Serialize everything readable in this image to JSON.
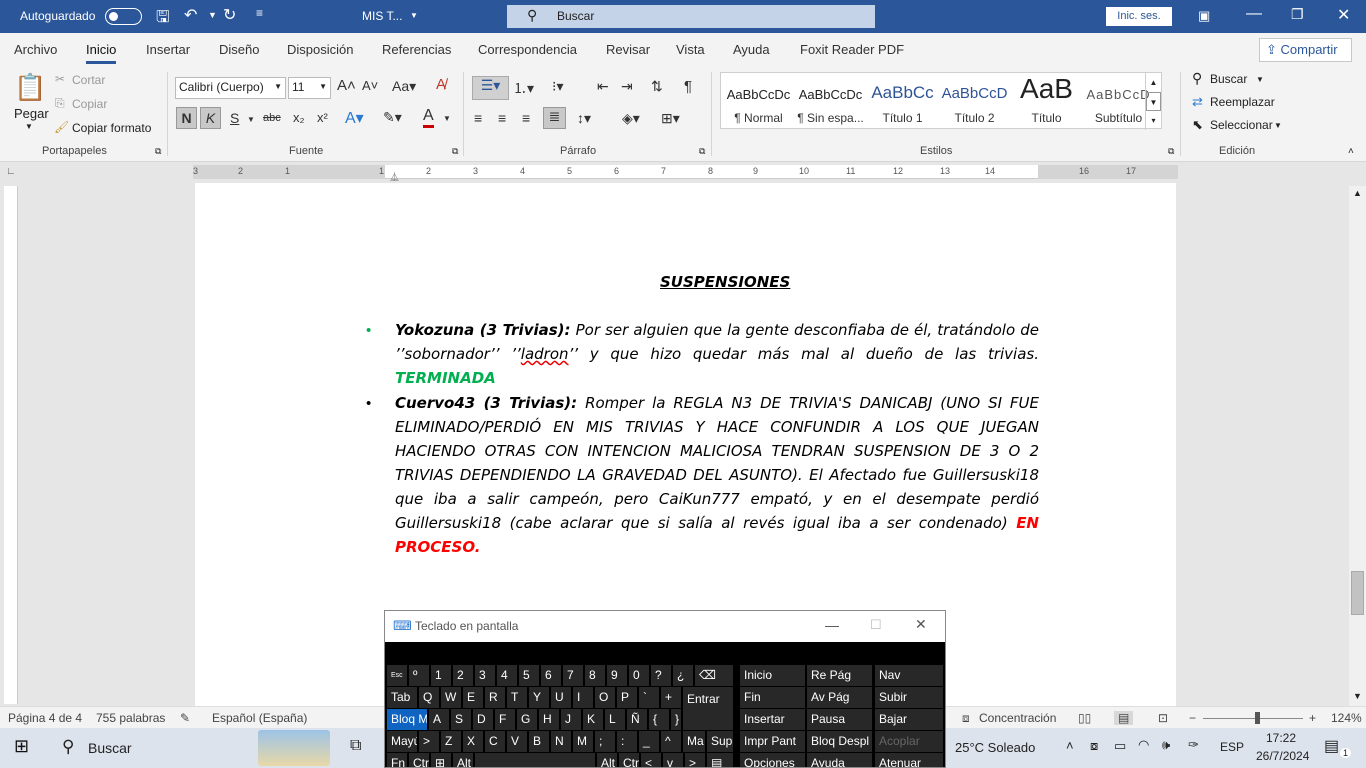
{
  "titlebar": {
    "autosave_label": "Autoguardado",
    "doc_title": "MIS T...",
    "search_placeholder": "Buscar",
    "signin_label": "Inic. ses."
  },
  "menu": {
    "tabs": [
      "Archivo",
      "Inicio",
      "Insertar",
      "Diseño",
      "Disposición",
      "Referencias",
      "Correspondencia",
      "Revisar",
      "Vista",
      "Ayuda",
      "Foxit Reader PDF"
    ],
    "share_label": "Compartir"
  },
  "ribbon": {
    "clipboard": {
      "paste": "Pegar",
      "cut": "Cortar",
      "copy": "Copiar",
      "format_painter": "Copiar formato",
      "group": "Portapapeles"
    },
    "font": {
      "font_name": "Calibri (Cuerpo)",
      "font_size": "11",
      "bold": "N",
      "italic": "K",
      "underline": "S",
      "strike": "abc",
      "subscript": "x₂",
      "superscript": "x²",
      "group": "Fuente"
    },
    "paragraph": {
      "group": "Párrafo"
    },
    "styles": {
      "group": "Estilos",
      "items": [
        {
          "preview": "AaBbCcDc",
          "name": "¶ Normal"
        },
        {
          "preview": "AaBbCcDc",
          "name": "¶ Sin espa..."
        },
        {
          "preview": "AaBbCc",
          "name": "Título 1"
        },
        {
          "preview": "AaBbCcD",
          "name": "Título 2"
        },
        {
          "preview": "AaB",
          "name": "Título"
        },
        {
          "preview": "AaBbCcD",
          "name": "Subtítulo"
        }
      ]
    },
    "editing": {
      "find": "Buscar",
      "replace": "Reemplazar",
      "select": "Seleccionar",
      "group": "Edición"
    }
  },
  "ruler": {
    "marks": [
      "3",
      "2",
      "1",
      "1",
      "2",
      "3",
      "4",
      "5",
      "6",
      "7",
      "8",
      "9",
      "10",
      "11",
      "12",
      "13",
      "14",
      "16",
      "17"
    ]
  },
  "document": {
    "title": "SUSPENSIONES",
    "items": [
      {
        "name": "Yokozuna (3 Trivias):",
        "text1": " Por ser alguien que la gente desconfiaba de él, tratándolo de ’’sobornador’’ ’’",
        "misspelled": "ladron",
        "text2": "’’ y que hizo quedar más mal al dueño de las trivias. ",
        "status": "TERMINADA"
      },
      {
        "name": "Cuervo43 (3 Trivias)",
        "colon": ":",
        "text": " Romper la REGLA N3 DE TRIVIA'S DANICABJ (UNO SI FUE ELIMINADO/PERDIÓ EN MIS TRIVIAS Y HACE CONFUNDIR A LOS QUE JUEGAN HACIENDO OTRAS CON INTENCION MALICIOSA TENDRAN SUSPENSION DE 3 O 2 TRIVIAS DEPENDIENDO LA GRAVEDAD DEL ASUNTO). El Afectado fue Guillersuski18 que iba a salir campeón, pero CaiKun777 empató, y en el desempate perdió Guillersuski18 (cabe aclarar que si salía al revés igual iba a ser condenado) ",
        "status": "EN PROCESO",
        "end": "."
      }
    ]
  },
  "statusbar": {
    "page": "Página 4 de 4",
    "words": "755 palabras",
    "language": "Español (España)",
    "focus": "Concentración",
    "zoom": "124%"
  },
  "taskbar": {
    "search": "Buscar",
    "weather": "25°C  Soleado",
    "lang": "ESP",
    "time": "17:22",
    "date": "26/7/2024",
    "notifications": "1"
  },
  "osk": {
    "title": "Teclado en pantalla",
    "row1": [
      "Esc",
      "º",
      "1",
      "2",
      "3",
      "4",
      "5",
      "6",
      "7",
      "8",
      "9",
      "0",
      "?",
      "¿",
      "⌫"
    ],
    "row2": [
      "Tab",
      "Q",
      "W",
      "E",
      "R",
      "T",
      "Y",
      "U",
      "I",
      "O",
      "P",
      "`",
      "+",
      "Entrar"
    ],
    "row3": [
      "Bloq M",
      "A",
      "S",
      "D",
      "F",
      "G",
      "H",
      "J",
      "K",
      "L",
      "Ñ",
      "{",
      "}"
    ],
    "row4": [
      "Mayú",
      ">",
      "Z",
      "X",
      "C",
      "V",
      "B",
      "N",
      "M",
      ";",
      ":",
      "_",
      "^",
      "Ma",
      "Supr"
    ],
    "row5": [
      "Fn",
      "Ctr",
      "⊞",
      "Alt",
      "",
      "Alt",
      "Ctr",
      "<",
      "v",
      ">",
      "▤"
    ],
    "nav": [
      [
        "Inicio",
        "Re Pág",
        "Nav"
      ],
      [
        "Fin",
        "Av Pág",
        "Subir"
      ],
      [
        "Insertar",
        "Pausa",
        "Bajar"
      ],
      [
        "Impr Pant",
        "Bloq Despl",
        "Acoplar"
      ],
      [
        "Opciones",
        "Ayuda",
        "Atenuar"
      ]
    ]
  }
}
